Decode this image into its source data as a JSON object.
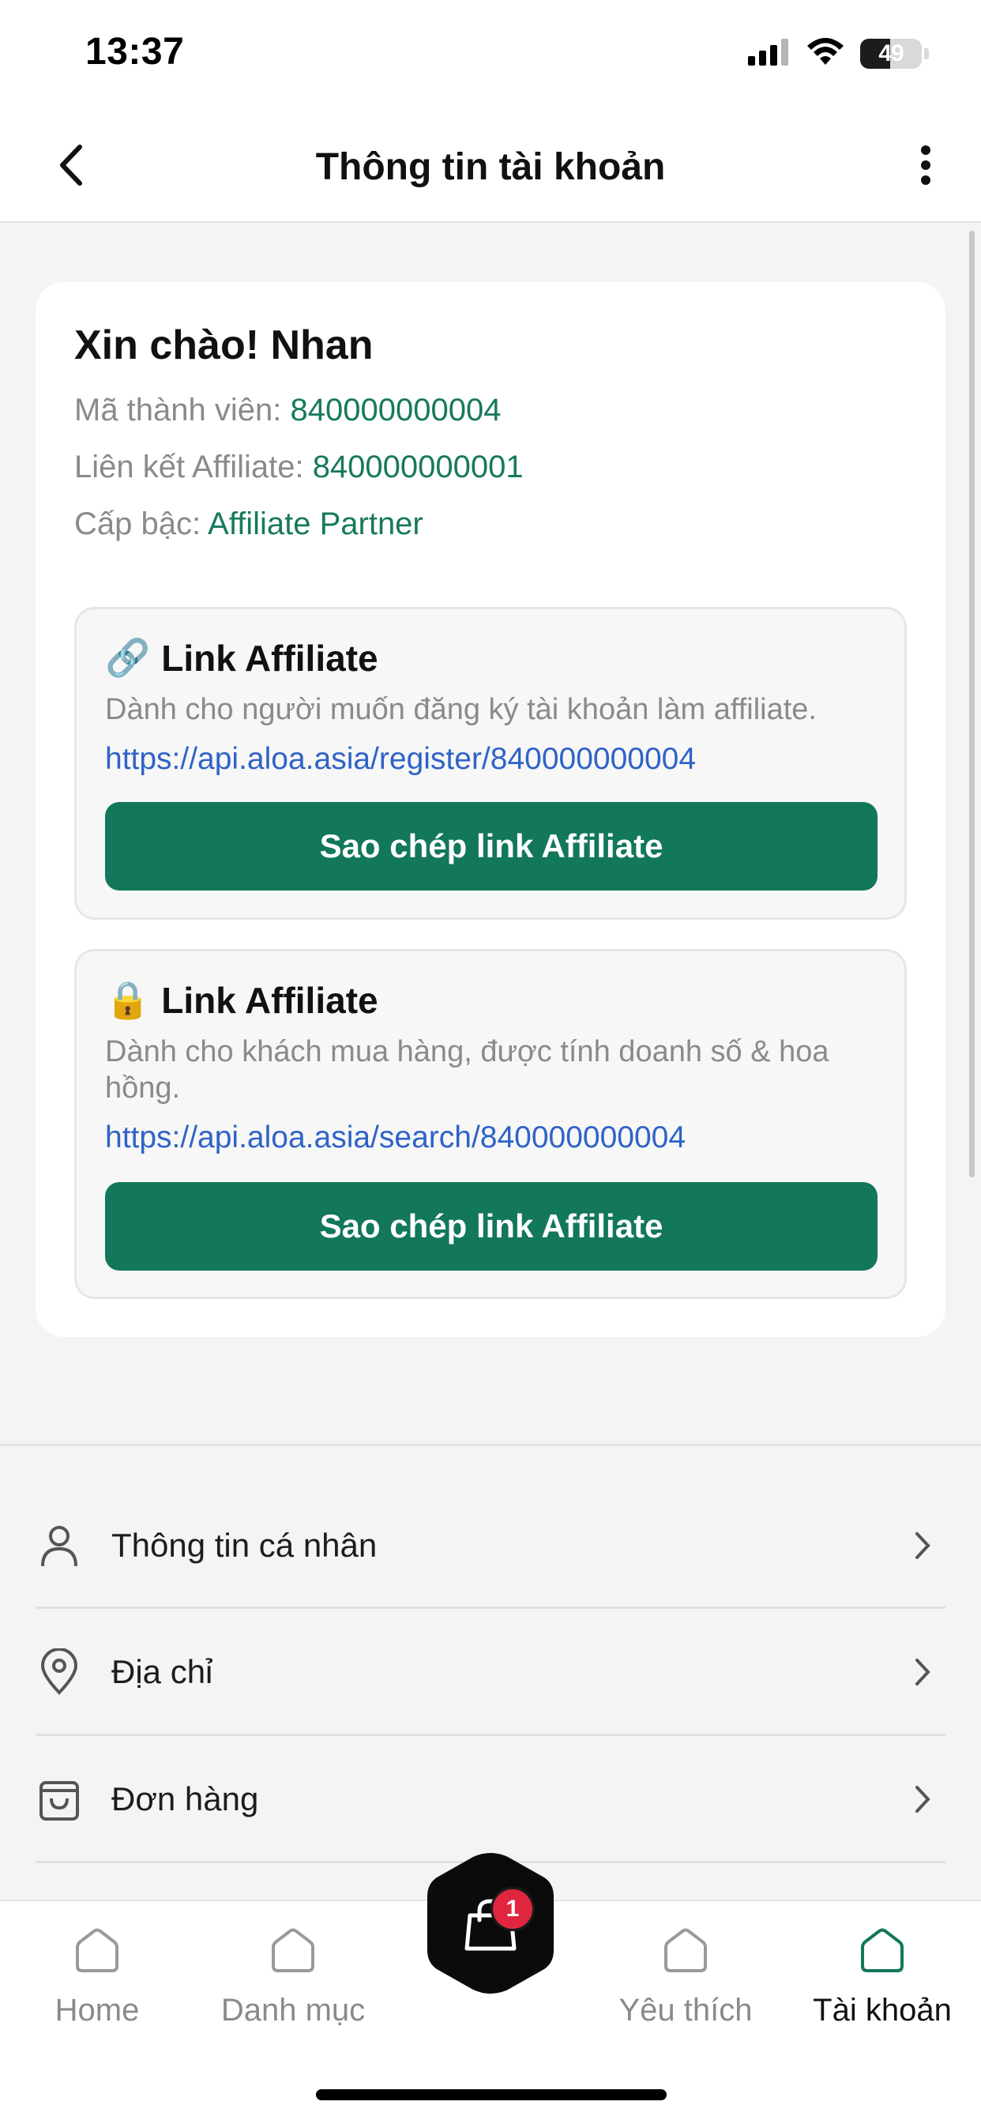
{
  "status_bar": {
    "time": "13:37",
    "battery_level": "49",
    "icons": [
      "cellular-signal-icon",
      "wifi-icon",
      "battery-icon"
    ]
  },
  "header": {
    "title": "Thông tin tài khoản",
    "back_icon": "chevron-left-icon",
    "more_icon": "more-vertical-icon"
  },
  "account": {
    "greeting": "Xin chào! Nhan",
    "member_label": "Mã thành viên: ",
    "member_value": "840000000004",
    "affiliate_label": "Liên kết Affiliate: ",
    "affiliate_value": "840000000001",
    "rank_label": "Cấp bậc: ",
    "rank_value": "Affiliate Partner"
  },
  "links": [
    {
      "emoji": "🔗",
      "title": "Link Affiliate",
      "description": "Dành cho người muốn đăng ký tài khoản làm affiliate.",
      "url": "https://api.aloa.asia/register/840000000004",
      "button": "Sao chép link Affiliate"
    },
    {
      "emoji": "🔒",
      "title": "Link Affiliate",
      "description": "Dành cho khách mua hàng, được tính doanh số & hoa hồng.",
      "url": "https://api.aloa.asia/search/840000000004",
      "button": "Sao chép link Affiliate"
    }
  ],
  "menu": [
    {
      "label": "Thông tin cá nhân",
      "icon": "user-icon"
    },
    {
      "label": "Địa chỉ",
      "icon": "location-pin-icon"
    },
    {
      "label": "Đơn hàng",
      "icon": "shopping-bag-icon"
    }
  ],
  "bottom_nav": {
    "items": [
      {
        "label": "Home",
        "icon": "home-icon",
        "active": false
      },
      {
        "label": "Danh mục",
        "icon": "home-icon",
        "active": false
      },
      {
        "label": "Yêu thích",
        "icon": "home-icon",
        "active": false
      },
      {
        "label": "Tài khoản",
        "icon": "home-icon",
        "active": true
      }
    ],
    "cart_badge": "1",
    "cart_icon": "shopping-bag-icon"
  },
  "colors": {
    "accent": "#12775b",
    "accent_text": "#17795d",
    "link": "#2f63c7",
    "badge": "#e0263e"
  }
}
